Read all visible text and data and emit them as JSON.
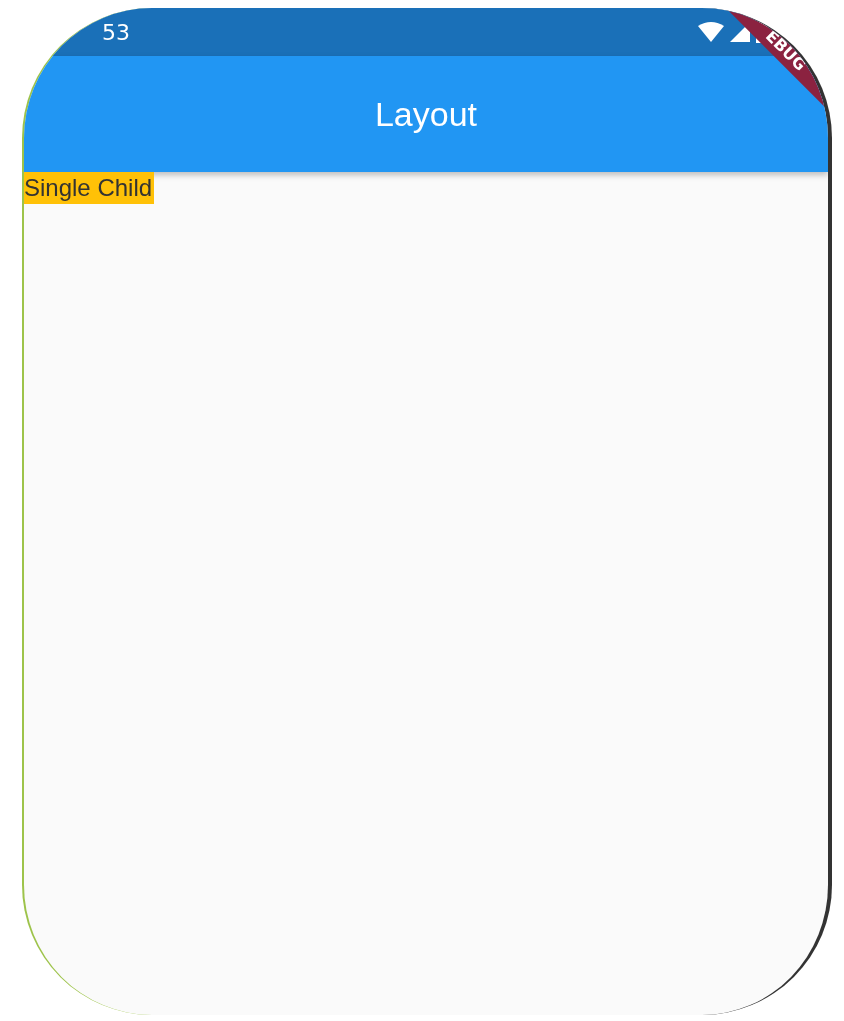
{
  "status_bar": {
    "time": "53"
  },
  "debug_banner": {
    "label": "EBUG"
  },
  "app_bar": {
    "title": "Layout"
  },
  "body": {
    "label": "Single Child"
  }
}
